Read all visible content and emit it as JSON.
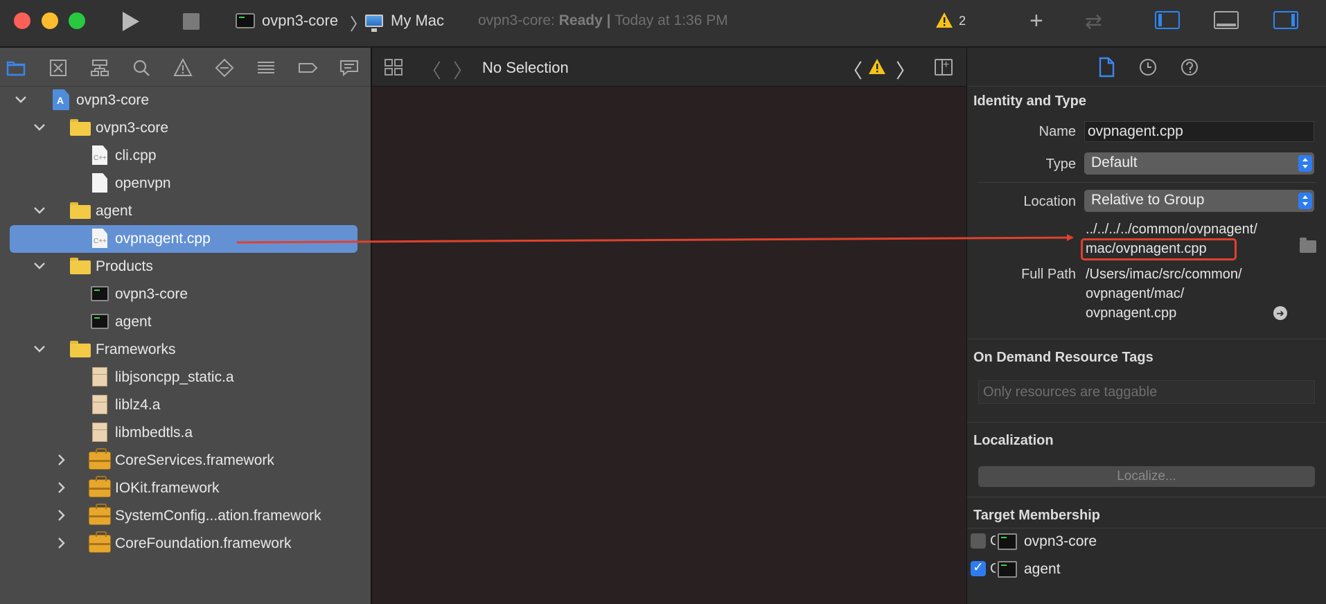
{
  "toolbar": {
    "scheme": "ovpn3-core",
    "separator": "〉",
    "destination": "My Mac",
    "status_project": "ovpn3-core: ",
    "status_state": "Ready",
    "status_sep": " | ",
    "status_time": "Today at 1:36 PM",
    "warning_count": "2",
    "add_glyph": "+",
    "swap_glyph": "⇄"
  },
  "navigator": {
    "tabs": [
      "folder-icon",
      "x-square-icon",
      "hierarchy-icon",
      "search-icon",
      "warning-icon",
      "test-diamond-icon",
      "debug-list-icon",
      "breakpoint-icon",
      "report-bubble-icon"
    ],
    "tree": [
      {
        "label": "ovpn3-core",
        "kind": "project",
        "expanded": true
      },
      {
        "label": "ovpn3-core",
        "kind": "folder",
        "expanded": true
      },
      {
        "label": "cli.cpp",
        "kind": "cpp"
      },
      {
        "label": "openvpn",
        "kind": "file"
      },
      {
        "label": "agent",
        "kind": "folder",
        "expanded": true
      },
      {
        "label": "ovpnagent.cpp",
        "kind": "cpp",
        "selected": true
      },
      {
        "label": "Products",
        "kind": "folder",
        "expanded": true
      },
      {
        "label": "ovpn3-core",
        "kind": "product"
      },
      {
        "label": "agent",
        "kind": "product"
      },
      {
        "label": "Frameworks",
        "kind": "folder",
        "expanded": true
      },
      {
        "label": "libjsoncpp_static.a",
        "kind": "library"
      },
      {
        "label": "liblz4.a",
        "kind": "library"
      },
      {
        "label": "libmbedtls.a",
        "kind": "library"
      },
      {
        "label": "CoreServices.framework",
        "kind": "framework",
        "expanded": false
      },
      {
        "label": "IOKit.framework",
        "kind": "framework",
        "expanded": false
      },
      {
        "label": "SystemConfig...ation.framework",
        "kind": "framework",
        "expanded": false
      },
      {
        "label": "CoreFoundation.framework",
        "kind": "framework",
        "expanded": false
      }
    ],
    "cpp_badge": "C++"
  },
  "editor": {
    "jump_bar_label": "No Selection",
    "back_glyph": "〈",
    "forward_glyph": "〉",
    "prev_issue_glyph": "〈",
    "next_issue_glyph": "〉"
  },
  "inspector": {
    "identity_title": "Identity and Type",
    "name_label": "Name",
    "name_value": "ovpnagent.cpp",
    "type_label": "Type",
    "type_value": "Default",
    "location_label": "Location",
    "location_value": "Relative to Group",
    "location_path_line1": "../../../../common/ovpnagent/",
    "location_path_line2": "mac/ovpnagent.cpp",
    "full_path_label": "Full Path",
    "full_path_line1": "/Users/imac/src/common/",
    "full_path_line2": "ovpnagent/mac/",
    "full_path_line3": "ovpnagent.cpp",
    "tags_title": "On Demand Resource Tags",
    "tags_placeholder": "Only resources are taggable",
    "localization_title": "Localization",
    "localize_button": "Localize...",
    "target_title": "Target Membership",
    "targets": [
      {
        "prefix": "C",
        "label": "ovpn3-core",
        "checked": false
      },
      {
        "prefix": "C",
        "label": "agent",
        "checked": true
      }
    ]
  },
  "colors": {
    "accent_blue": "#2f7cf0",
    "selection": "#6391d4",
    "annotation_red": "#e0412d",
    "warning_yellow": "#f5c21b"
  }
}
